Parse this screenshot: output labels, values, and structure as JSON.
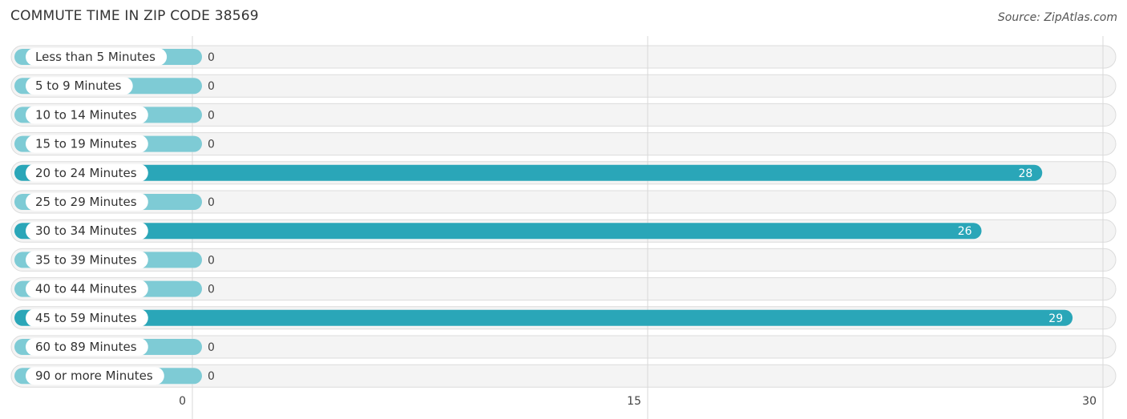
{
  "chart_data": {
    "type": "bar",
    "orientation": "horizontal",
    "title": "COMMUTE TIME IN ZIP CODE 38569",
    "source": "Source: ZipAtlas.com",
    "categories": [
      "Less than 5 Minutes",
      "5 to 9 Minutes",
      "10 to 14 Minutes",
      "15 to 19 Minutes",
      "20 to 24 Minutes",
      "25 to 29 Minutes",
      "30 to 34 Minutes",
      "35 to 39 Minutes",
      "40 to 44 Minutes",
      "45 to 59 Minutes",
      "60 to 89 Minutes",
      "90 or more Minutes"
    ],
    "values": [
      0,
      0,
      0,
      0,
      28,
      0,
      26,
      0,
      0,
      29,
      0,
      0
    ],
    "xlim": [
      0,
      30
    ],
    "xticks": [
      0,
      15,
      30
    ],
    "xlabel": "",
    "ylabel": "",
    "grid": true,
    "legend": "none",
    "colors": {
      "bar": "#2aa6b8",
      "bar_zero": "#7ecbd5"
    }
  }
}
